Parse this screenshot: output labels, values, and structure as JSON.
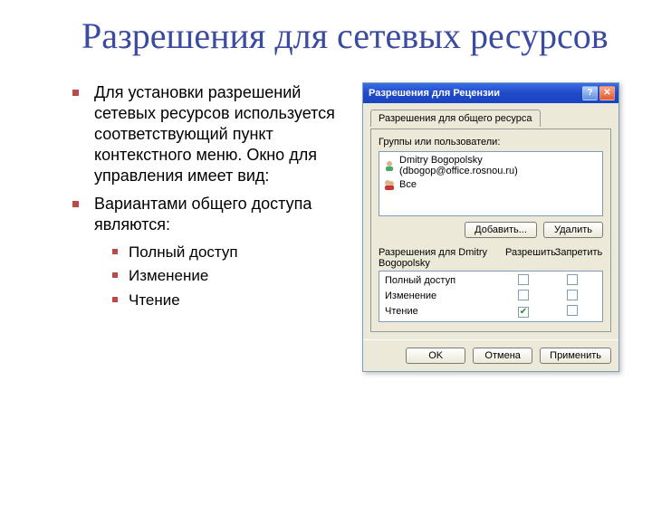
{
  "title": "Разрешения для сетевых ресурсов",
  "bullets": {
    "b1": "Для установки разрешений сетевых ресурсов используется соответствующий пункт контекстного меню. Окно для управления имеет вид:",
    "b2": "Вариантами общего доступа являются:",
    "sub1": "Полный доступ",
    "sub2": "Изменение",
    "sub3": "Чтение"
  },
  "dialog": {
    "title": "Разрешения для Рецензии",
    "help_glyph": "?",
    "close_glyph": "✕",
    "tab": "Разрешения для общего ресурса",
    "groups_label": "Группы или пользователи:",
    "users": [
      "Dmitry Bogopolsky (dbogop@office.rosnou.ru)",
      "Все"
    ],
    "btn_add": "Добавить...",
    "btn_remove": "Удалить",
    "perm_for": "Разрешения для Dmitry Bogopolsky",
    "col_allow": "Разрешить",
    "col_deny": "Запретить",
    "perms": [
      {
        "name": "Полный доступ",
        "allow": false,
        "deny": false
      },
      {
        "name": "Изменение",
        "allow": false,
        "deny": false
      },
      {
        "name": "Чтение",
        "allow": true,
        "deny": false
      }
    ],
    "ok": "OK",
    "cancel": "Отмена",
    "apply": "Применить"
  }
}
